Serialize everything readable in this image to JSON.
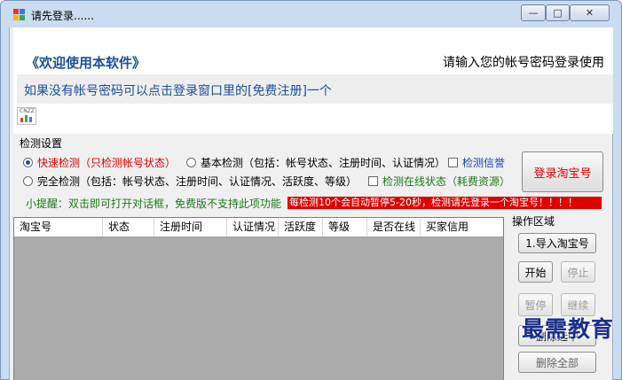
{
  "window": {
    "title": "请先登录......",
    "controls": {
      "minimize": "—",
      "maximize": "□",
      "close": "✕"
    }
  },
  "banner": {
    "welcome": "《欢迎使用本软件》",
    "login_hint": "请输入您的帐号密码登录使用",
    "notice": "如果没有帐号密码可以点击登录窗口里的[免费注册]一个",
    "counter_icon_label": "CNZZ"
  },
  "detection": {
    "group_label": "检测设置",
    "options": {
      "quick": "快速检测（只检测帐号状态）",
      "basic": "基本检测（包括：帐号状态、注册时间、认证情况）",
      "full": "完全检测（包括：帐号状态、注册时间、认证情况、活跃度、等级）",
      "check_credit": "检测信誉",
      "check_online": "检测在线状态（耗费资源）"
    },
    "selected_option": "quick",
    "login_button": "登录淘宝号"
  },
  "tips": {
    "hint": "小提醒：双击即可打开对话框，免费版不支持此项功能",
    "warning": "每检测10个会自动暂停5-20秒，检测请先登录一个淘宝号！！！！"
  },
  "table": {
    "columns": [
      "淘宝号",
      "状态",
      "注册时间",
      "认证情况",
      "活跃度",
      "等级",
      "是否在线",
      "买家信用"
    ]
  },
  "operations": {
    "label": "操作区域",
    "import": "1.导入淘宝号",
    "start": "开始",
    "stop": "停止",
    "pause": "暂停",
    "resume": "继续",
    "delete_selected": "删除选中",
    "partial_button": "删除全部"
  },
  "watermark": "最需教育",
  "colors": {
    "accent_blue": "#1b4f9b",
    "warning_red": "#e00000",
    "tip_green": "#1a7a1a",
    "grid_gray": "#ababab"
  }
}
